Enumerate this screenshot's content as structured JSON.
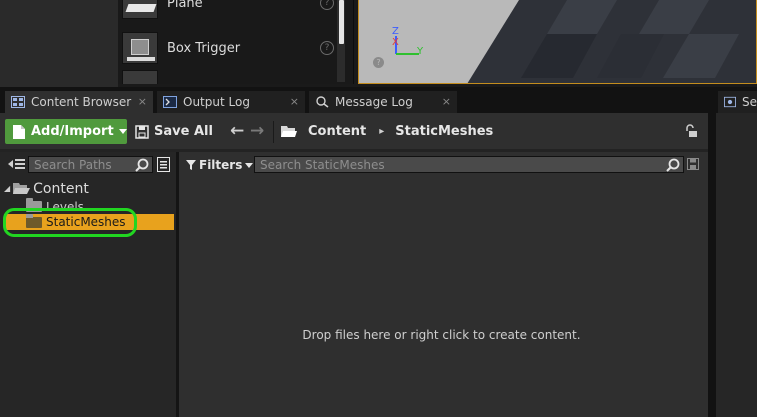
{
  "place_actors": {
    "items": [
      {
        "label": "Plane",
        "help_icon": "help-circle-icon"
      },
      {
        "label": "Box Trigger",
        "help_icon": "help-circle-icon"
      }
    ],
    "help_glyph": "?"
  },
  "viewport": {
    "axis_z": "Z",
    "axis_x": "X",
    "axis_y": "Y"
  },
  "tabs": [
    {
      "label": "Content Browser",
      "icon": "content-browser-icon",
      "active": true,
      "close": "×"
    },
    {
      "label": "Output Log",
      "icon": "output-log-icon",
      "active": false,
      "close": "×"
    },
    {
      "label": "Message Log",
      "icon": "message-log-icon",
      "active": false,
      "close": "×"
    },
    {
      "label": "Se",
      "icon": "settings-icon",
      "active": false
    }
  ],
  "toolbar": {
    "add_import_label": "Add/Import",
    "save_all_label": "Save All",
    "back_glyph": "←",
    "forward_glyph": "→"
  },
  "breadcrumb": {
    "items": [
      "Content",
      "StaticMeshes"
    ],
    "separator": "▸"
  },
  "sources_panel": {
    "search_placeholder": "Search Paths",
    "tree": [
      {
        "label": "Content",
        "expanded": true,
        "level": 0
      },
      {
        "label": "Levels",
        "level": 1
      },
      {
        "label": "StaticMeshes",
        "level": 1,
        "selected": true
      }
    ]
  },
  "asset_view": {
    "filters_label": "Filters",
    "search_placeholder": "Search StaticMeshes",
    "empty_message": "Drop files here or right click to create content."
  },
  "colors": {
    "accent_green": "#509a3d",
    "selection_orange": "#e8a21d",
    "highlight_ring": "#21d621"
  }
}
